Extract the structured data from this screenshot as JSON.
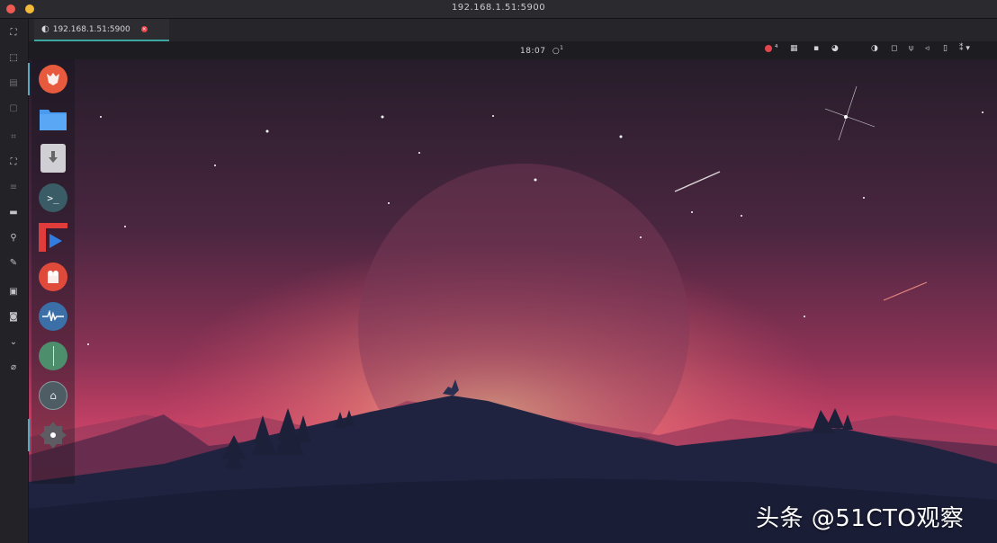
{
  "window": {
    "title": "192.168.1.51:5900"
  },
  "tab": {
    "label": "192.168.1.51:5900",
    "close_icon": "close-icon"
  },
  "toolbar_icons": [
    "fullscreen-icon",
    "fit-screen-icon",
    "scale-icon",
    "clipboard-icon",
    "keyboard-icon",
    "screenshot-icon",
    "settings-icon",
    "key-icon",
    "wrench-icon",
    "display-icon",
    "camera-icon",
    "chevron-down-icon",
    "disconnect-icon"
  ],
  "panel": {
    "clock": "18:07",
    "clock_suffix": "1",
    "tray": [
      "notification-icon",
      "keyboard-layout-icon",
      "network-icon",
      "user-icon",
      "bluetooth-icon",
      "accessibility-icon",
      "wifi-icon",
      "audio-icon",
      "battery-icon",
      "language-icon"
    ]
  },
  "dock": {
    "items": [
      {
        "name": "firefox-icon",
        "color": "#e75a3d"
      },
      {
        "name": "files-icon",
        "color": "#4a9bf0"
      },
      {
        "name": "installer-icon",
        "color": "#c8c8cc"
      },
      {
        "name": "terminal-icon",
        "color": "#3a5c66"
      },
      {
        "name": "media-player-icon",
        "color": "#e03c3c"
      },
      {
        "name": "boxes-icon",
        "color": "#e04a3a"
      },
      {
        "name": "audio-editor-icon",
        "color": "#3a6fa8"
      },
      {
        "name": "app-icon-green",
        "color": "#4d8f6d"
      },
      {
        "name": "system-monitor-icon",
        "color": "#5a6a72"
      },
      {
        "name": "settings-icon",
        "color": "#5c5c62"
      }
    ]
  },
  "colors": {
    "sky_top": "#2a1e2c",
    "sky_mid": "#7a2e52",
    "horizon": "#e04a6a",
    "glow": "#f2a17a",
    "mountain": "#1f2340",
    "accent": "#3ea6a0"
  },
  "watermark": "头条 @51CTO观察"
}
